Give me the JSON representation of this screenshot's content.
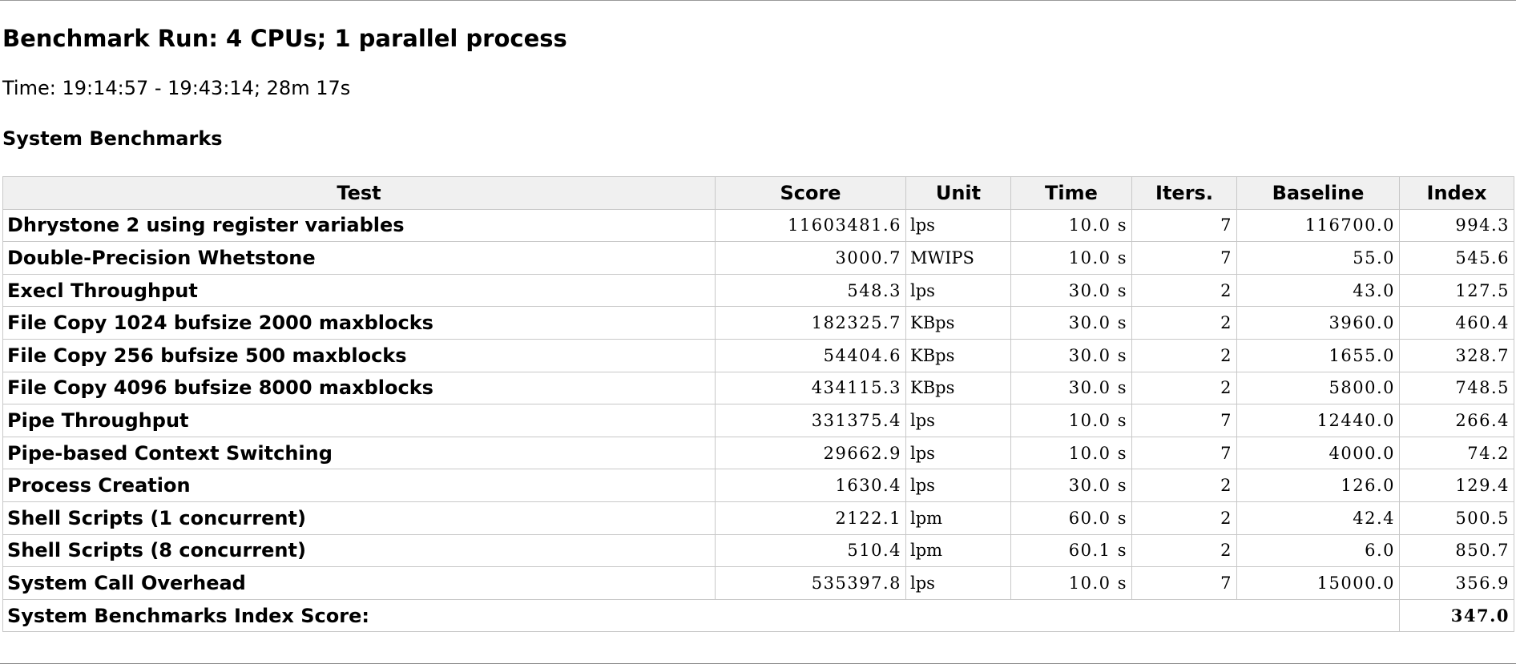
{
  "header": {
    "title": "Benchmark Run: 4 CPUs; 1 parallel process",
    "time": "Time: 19:14:57 - 19:43:14; 28m 17s",
    "section": "System Benchmarks"
  },
  "table": {
    "columns": [
      "Test",
      "Score",
      "Unit",
      "Time",
      "Iters.",
      "Baseline",
      "Index"
    ],
    "rows": [
      {
        "test": "Dhrystone 2 using register variables",
        "score": "11603481.6",
        "unit": "lps",
        "time": "10.0 s",
        "iters": "7",
        "baseline": "116700.0",
        "index": "994.3"
      },
      {
        "test": "Double-Precision Whetstone",
        "score": "3000.7",
        "unit": "MWIPS",
        "time": "10.0 s",
        "iters": "7",
        "baseline": "55.0",
        "index": "545.6"
      },
      {
        "test": "Execl Throughput",
        "score": "548.3",
        "unit": "lps",
        "time": "30.0 s",
        "iters": "2",
        "baseline": "43.0",
        "index": "127.5"
      },
      {
        "test": "File Copy 1024 bufsize 2000 maxblocks",
        "score": "182325.7",
        "unit": "KBps",
        "time": "30.0 s",
        "iters": "2",
        "baseline": "3960.0",
        "index": "460.4"
      },
      {
        "test": "File Copy 256 bufsize 500 maxblocks",
        "score": "54404.6",
        "unit": "KBps",
        "time": "30.0 s",
        "iters": "2",
        "baseline": "1655.0",
        "index": "328.7"
      },
      {
        "test": "File Copy 4096 bufsize 8000 maxblocks",
        "score": "434115.3",
        "unit": "KBps",
        "time": "30.0 s",
        "iters": "2",
        "baseline": "5800.0",
        "index": "748.5"
      },
      {
        "test": "Pipe Throughput",
        "score": "331375.4",
        "unit": "lps",
        "time": "10.0 s",
        "iters": "7",
        "baseline": "12440.0",
        "index": "266.4"
      },
      {
        "test": "Pipe-based Context Switching",
        "score": "29662.9",
        "unit": "lps",
        "time": "10.0 s",
        "iters": "7",
        "baseline": "4000.0",
        "index": "74.2"
      },
      {
        "test": "Process Creation",
        "score": "1630.4",
        "unit": "lps",
        "time": "30.0 s",
        "iters": "2",
        "baseline": "126.0",
        "index": "129.4"
      },
      {
        "test": "Shell Scripts (1 concurrent)",
        "score": "2122.1",
        "unit": "lpm",
        "time": "60.0 s",
        "iters": "2",
        "baseline": "42.4",
        "index": "500.5"
      },
      {
        "test": "Shell Scripts (8 concurrent)",
        "score": "510.4",
        "unit": "lpm",
        "time": "60.1 s",
        "iters": "2",
        "baseline": "6.0",
        "index": "850.7"
      },
      {
        "test": "System Call Overhead",
        "score": "535397.8",
        "unit": "lps",
        "time": "10.0 s",
        "iters": "7",
        "baseline": "15000.0",
        "index": "356.9"
      }
    ],
    "total_label": "System Benchmarks Index Score:",
    "total_value": "347.0"
  }
}
